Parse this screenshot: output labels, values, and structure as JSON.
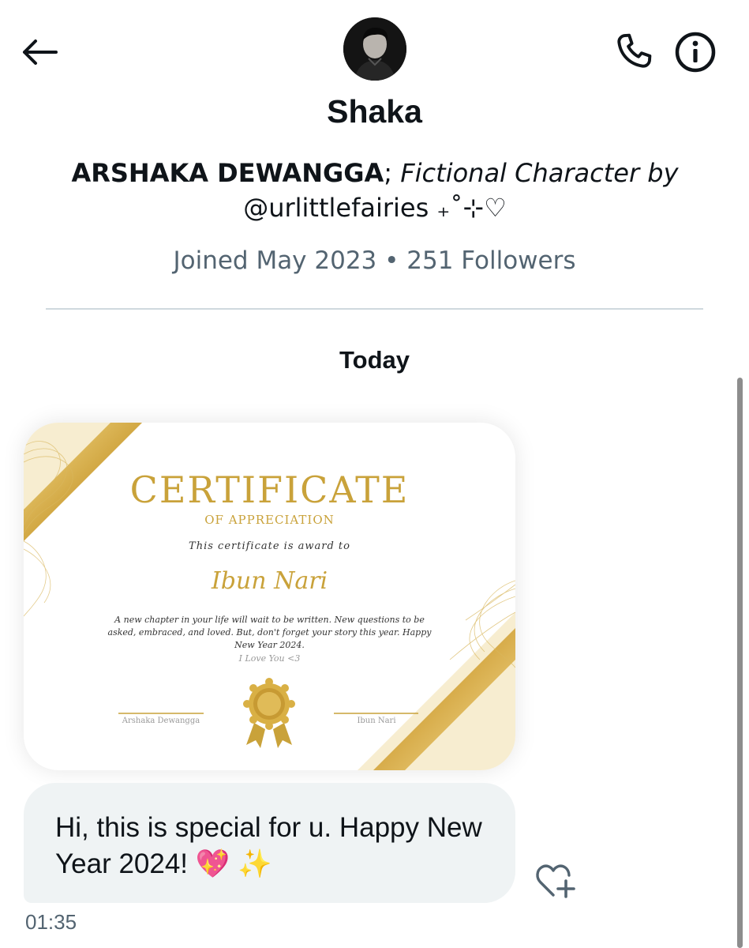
{
  "header": {
    "avatar_icon": "profile-photo",
    "back_icon": "arrow-left-icon",
    "call_icon": "phone-icon",
    "info_icon": "info-icon"
  },
  "profile": {
    "name": "Shaka",
    "bio_bold": "ARSHAKA DEWANGGA",
    "bio_sep": ";",
    "bio_italic": "Fictional Character by",
    "bio_handle": "@urlittlefairies ₊˚⊹♡",
    "meta": "Joined May 2023 • 251 Followers"
  },
  "conversation": {
    "day_label": "Today",
    "certificate": {
      "title": "CERTIFICATE",
      "subtitle": "OF APPRECIATION",
      "awarded_line": "This certificate is award to",
      "recipient": "Ibun Nari",
      "message": "A new chapter in your life will wait to be written. New questions to be asked, embraced, and loved. But, don't forget your story this year. Happy New Year 2024.",
      "love_note": "I Love You <3",
      "signer_left": "Arshaka Dewangga",
      "signer_right": "Ibun Nari",
      "accent_color": "#c9a23a"
    },
    "message": {
      "text": "Hi, this is special for u. Happy New Year 2024! 💖 ✨",
      "timestamp": "01:35",
      "react_icon": "heart-plus-icon"
    }
  },
  "colors": {
    "text_primary": "#0f1419",
    "text_secondary": "#536471",
    "bubble_bg": "#eff3f4",
    "gold": "#c9a23a"
  }
}
